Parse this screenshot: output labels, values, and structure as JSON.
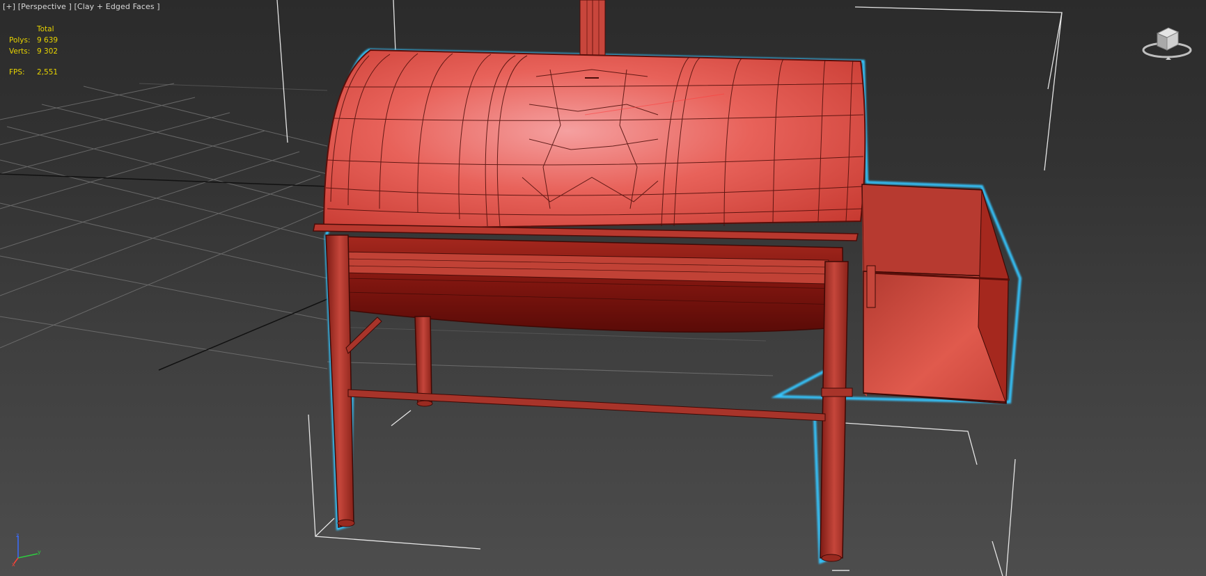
{
  "viewport": {
    "label_plus": "[+]",
    "label_view": "[Perspective ]",
    "label_shading": "[Clay + Edged Faces ]"
  },
  "stats": {
    "header": "Total",
    "polys_label": "Polys:",
    "polys_value": "9 639",
    "verts_label": "Verts:",
    "verts_value": "9 302",
    "fps_label": "FPS:",
    "fps_value": "2,551"
  },
  "icons": {
    "viewcube": "viewcube-icon",
    "axis": "axis-tripod-icon"
  },
  "colors": {
    "stats_text": "#e8d400",
    "selection_outline": "#35c6ff",
    "clay": "#d9463a",
    "grid": "#7a7a7a"
  }
}
